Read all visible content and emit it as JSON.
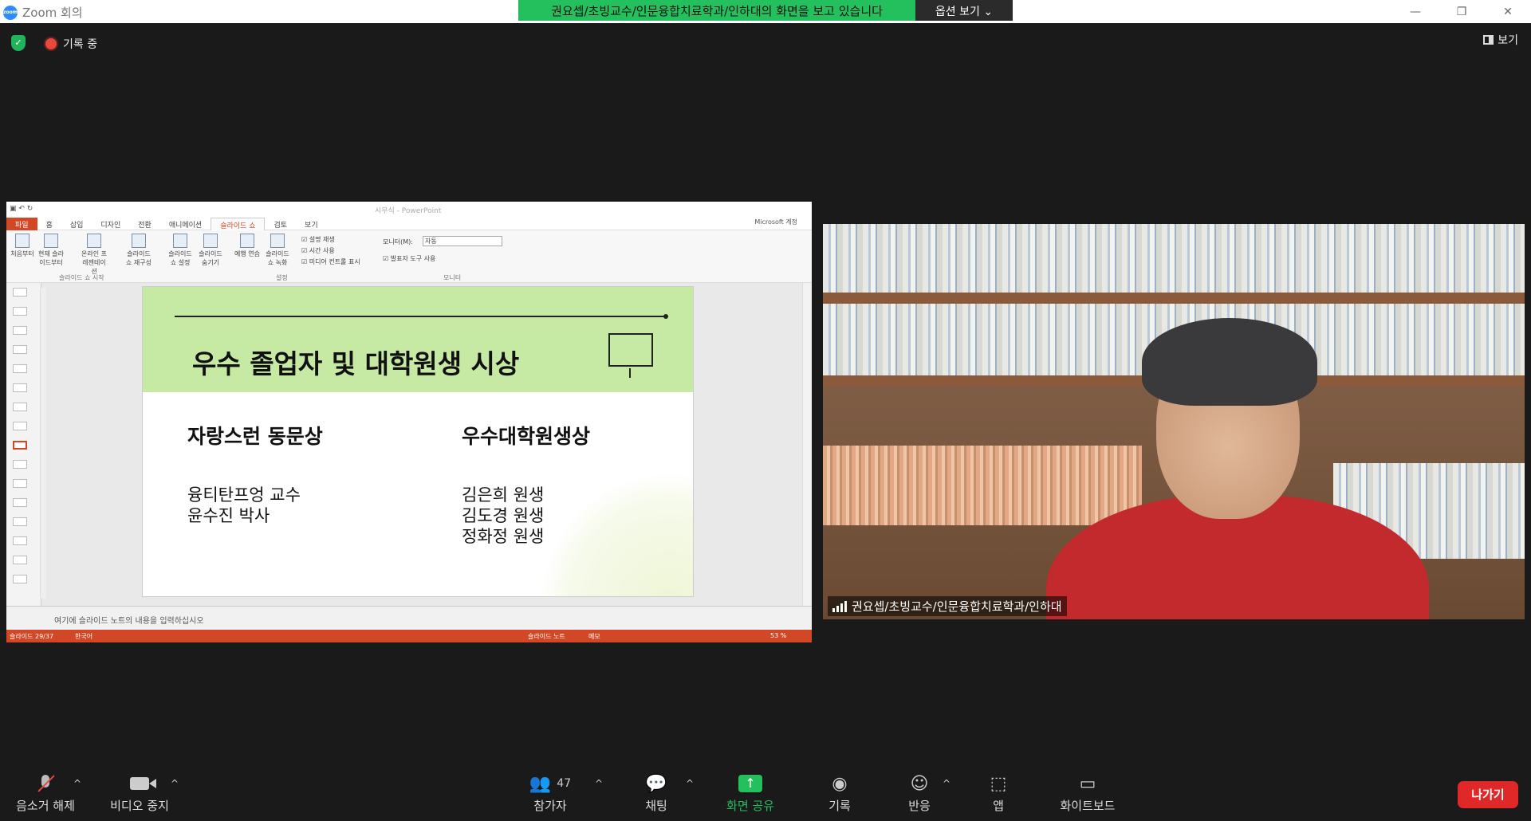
{
  "window": {
    "title": "Zoom 회의",
    "logo_text": "zoom",
    "controls": [
      "—",
      "❐",
      "✕"
    ]
  },
  "banner": {
    "viewing_text": "권요셉/초빙교수/인문융합치료학과/인하대의 화면을 보고 있습니다",
    "options_label": "옵션 보기 ⌄"
  },
  "status": {
    "recording_label": "기록 중",
    "view_label": "보기"
  },
  "powerpoint": {
    "doc_title": "시무식 - PowerPoint",
    "tabs": [
      "파일",
      "홈",
      "삽입",
      "디자인",
      "전환",
      "애니메이션",
      "슬라이드 쇼",
      "검토",
      "보기"
    ],
    "account": "Microsoft 계정",
    "ribbon": {
      "items": [
        "처음부터",
        "현재 슬라이드부터",
        "온라인 프레젠테이션",
        "슬라이드 쇼 재구성",
        "슬라이드 쇼 설정",
        "슬라이드 숨기기",
        "예행 연습",
        "슬라이드 쇼 녹화"
      ],
      "checks": [
        "설명 재생",
        "시간 사용",
        "미디어 컨트롤 표시"
      ],
      "monitor_label": "모니터(M):",
      "monitor_value": "자동",
      "presenter_check": "발표자 도구 사용",
      "groups": [
        "슬라이드 쇼 시작",
        "설정",
        "모니터"
      ]
    },
    "slide": {
      "title": "우수 졸업자 및 대학원생 시상",
      "left_heading": "자랑스런 동문상",
      "left_names": [
        "융티탄프엉 교수",
        "윤수진 박사"
      ],
      "right_heading": "우수대학원생상",
      "right_names": [
        "김은희 원생",
        "김도경 원생",
        "정화정 원생"
      ]
    },
    "notes_placeholder": "여기에 슬라이드 노트의 내용을 입력하십시오",
    "statusbar": {
      "slide_count": "슬라이드 29/37",
      "language": "한국어",
      "notes": "슬라이드 노트",
      "memo": "메모",
      "zoom": "53 %"
    }
  },
  "video": {
    "participant_name": "권요셉/초빙교수/인문융합치료학과/인하대"
  },
  "toolbar": {
    "mute_label": "음소거 해제",
    "video_label": "비디오 중지",
    "participants_label": "참가자",
    "participants_count": "47",
    "chat_label": "채팅",
    "share_label": "화면 공유",
    "record_label": "기록",
    "reactions_label": "반응",
    "apps_label": "앱",
    "whiteboard_label": "화이트보드",
    "leave_label": "나가기"
  },
  "colors": {
    "zoom_green": "#23c05d",
    "ppt_orange": "#d24726",
    "leave_red": "#e02828",
    "slide_header": "#c6e9a3"
  }
}
